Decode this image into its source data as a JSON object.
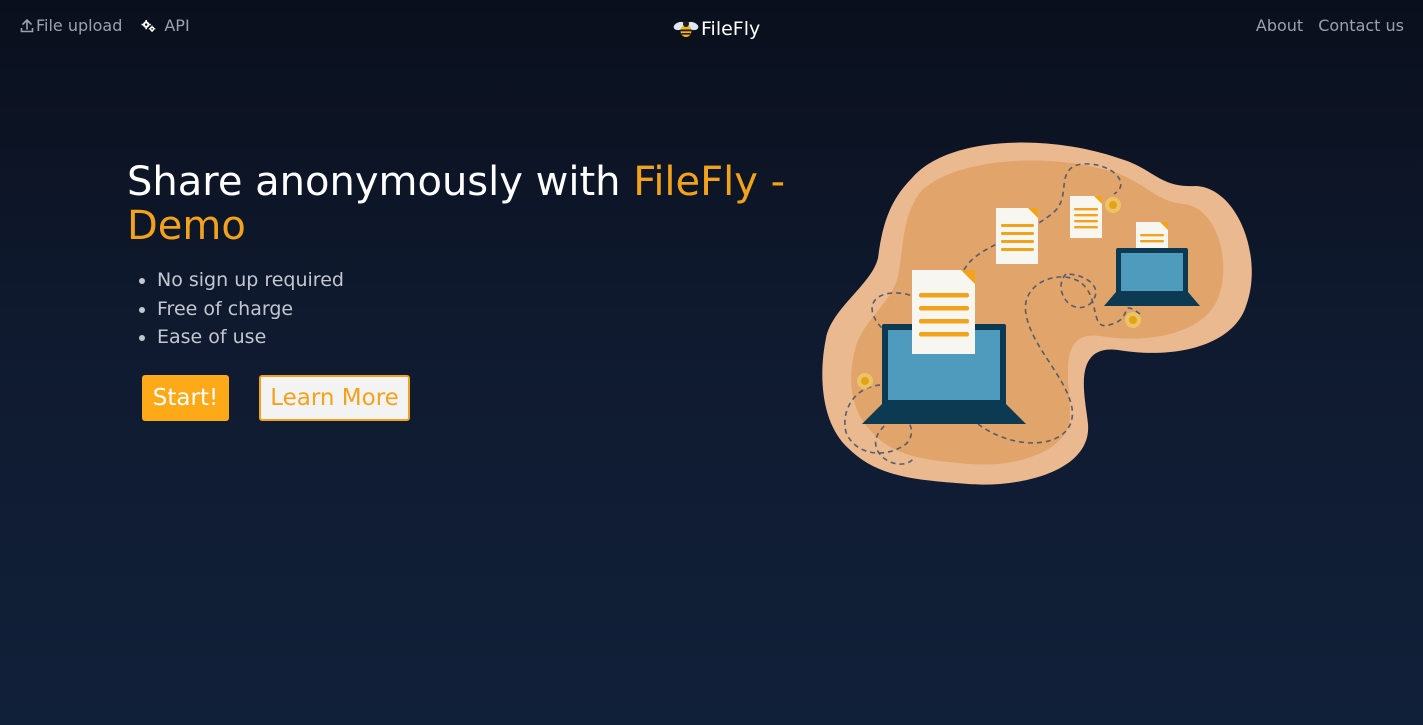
{
  "nav": {
    "file_upload_label": "File upload",
    "api_label": "API",
    "brand_name": "FileFly",
    "about_label": "About",
    "contact_label": "Contact us"
  },
  "hero": {
    "title_prefix": "Share anonymously with ",
    "title_accent": "FileFly - Demo",
    "features": [
      "No sign up required",
      "Free of charge",
      "Ease of use"
    ],
    "start_button": "Start!",
    "learn_more_button": "Learn More"
  },
  "icons": {
    "upload": "upload-icon",
    "api": "gears-icon",
    "brand": "bee-logo-icon"
  },
  "colors": {
    "accent": "#f2a21b",
    "button_primary": "#fea918",
    "background_top": "#0a0f1c",
    "background_bottom": "#112039",
    "nav_text": "#9ba2ad"
  }
}
